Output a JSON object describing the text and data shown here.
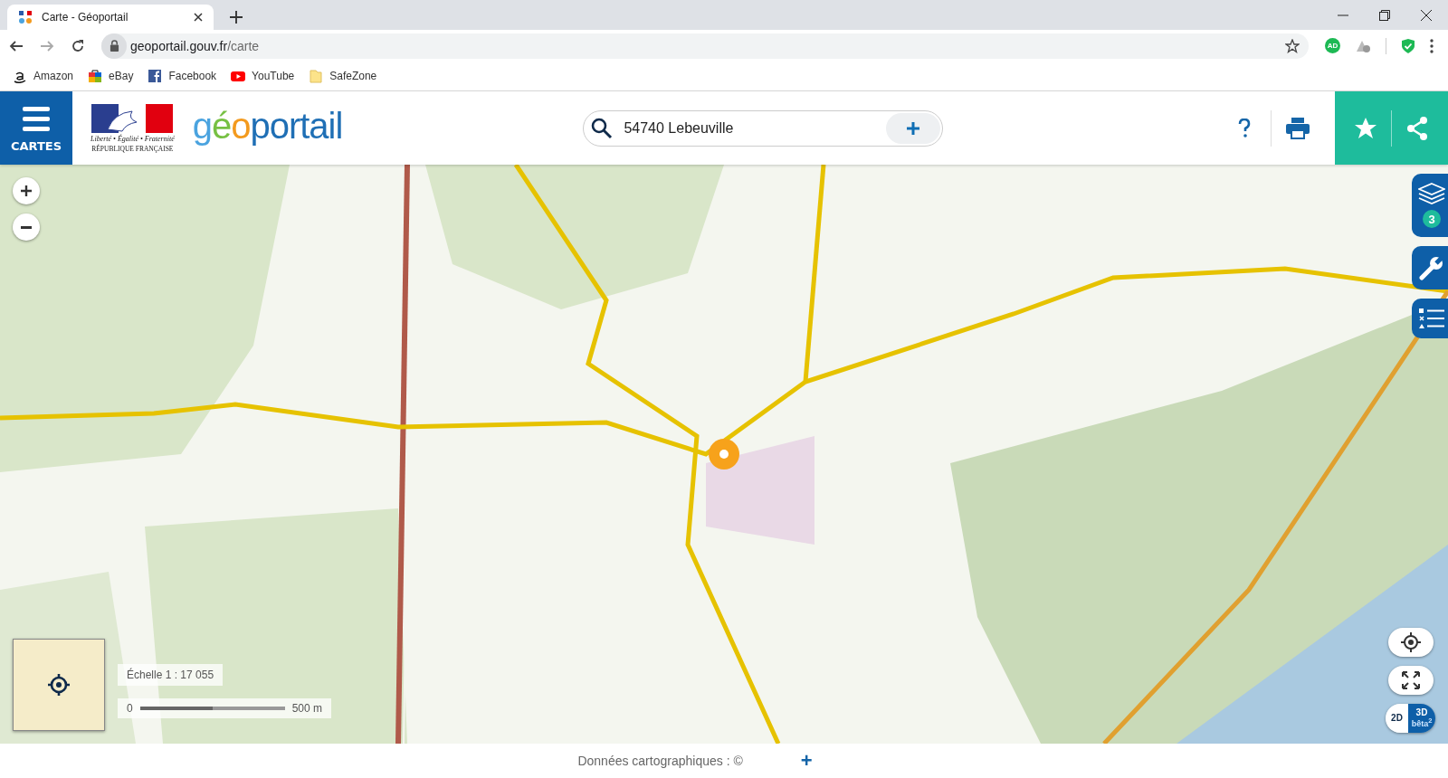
{
  "browser": {
    "tab": {
      "title": "Carte - Géoportail",
      "selected": true
    },
    "url": {
      "host": "geoportail.gouv.fr",
      "path": "/carte"
    },
    "bookmarks": [
      {
        "label": "Amazon",
        "kind": "amazon"
      },
      {
        "label": "eBay",
        "kind": "ebay"
      },
      {
        "label": "Facebook",
        "kind": "facebook"
      },
      {
        "label": "YouTube",
        "kind": "youtube"
      },
      {
        "label": "SafeZone",
        "kind": "folder"
      }
    ],
    "extensions": [
      {
        "label": "AD",
        "kind": "adblock"
      },
      {
        "kind": "cloud"
      },
      {
        "kind": "shield"
      }
    ]
  },
  "header": {
    "menu_label": "CARTES",
    "republic": {
      "motto": "Liberté • Égalité • Fraternité",
      "name": "RÉPUBLIQUE FRANÇAISE"
    },
    "logo": "géoportail",
    "search": {
      "value": "54740 Lebeuville"
    }
  },
  "map": {
    "right_tools": [
      {
        "kind": "layers",
        "badge": "3"
      },
      {
        "kind": "tools"
      },
      {
        "kind": "legend"
      }
    ],
    "scale": "Échelle 1 : 17 055",
    "scale_bar": {
      "start": "0",
      "end": "500 m"
    },
    "view_modes": [
      {
        "label": "2D",
        "selected": false
      },
      {
        "label": "3D",
        "sub": "bêta$^{2}$",
        "selected": true
      }
    ]
  },
  "footer": {
    "credits": "Données cartographiques : ©",
    "plus": "+"
  }
}
